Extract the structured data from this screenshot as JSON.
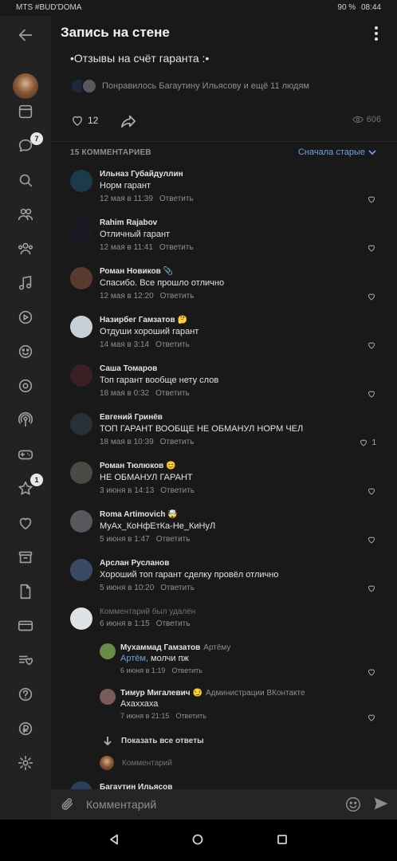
{
  "status_bar": {
    "carrier": "MTS #BUD'DOMA",
    "battery": "90 %",
    "time": "08:44"
  },
  "header": {
    "back_icon": "arrow-left-icon",
    "title": "Запись на стене",
    "menu_icon": "more-vertical-icon"
  },
  "sidebar": {
    "items": [
      {
        "icon": "profile-avatar"
      },
      {
        "icon": "news-icon"
      },
      {
        "icon": "messages-icon",
        "badge": "7"
      },
      {
        "icon": "search-icon"
      },
      {
        "icon": "friends-icon"
      },
      {
        "icon": "communities-icon"
      },
      {
        "icon": "music-icon"
      },
      {
        "icon": "video-icon"
      },
      {
        "icon": "games-icon"
      },
      {
        "icon": "clips-icon"
      },
      {
        "icon": "podcasts-icon"
      },
      {
        "icon": "gamepad-icon"
      },
      {
        "icon": "bookmarks-icon",
        "badge": "1"
      },
      {
        "icon": "likes-icon"
      },
      {
        "icon": "archive-icon"
      },
      {
        "icon": "documents-icon"
      },
      {
        "icon": "payments-icon"
      },
      {
        "icon": "wishlist-icon"
      },
      {
        "icon": "help-icon"
      },
      {
        "icon": "ruble-icon"
      },
      {
        "icon": "settings-icon"
      }
    ]
  },
  "post": {
    "text": "•Отзывы на счёт гаранта :•",
    "liked_by_text": "Понравилось Багаутину Ильясову и ещё 11 людям",
    "likes": "12",
    "views": "606"
  },
  "comments_section": {
    "count_label": "15 КОММЕНТАРИЕВ",
    "sort_label": "Сначала старые"
  },
  "comments": [
    {
      "author": "Ильназ Губайдуллин",
      "emoji": "",
      "text": "Норм гарант",
      "date": "12 мая в 11:39",
      "reply": "Ответить",
      "likes": "",
      "avatar_color": "#1b3a4a"
    },
    {
      "author": "Rahim Rajabov",
      "emoji": "",
      "text": "Отличный  гарант",
      "date": "12 мая в 11:41",
      "reply": "Ответить",
      "likes": "",
      "avatar_color": "#1a1a24"
    },
    {
      "author": "Роман Новиков",
      "emoji": "📎",
      "text": "Спасибо. Все прошло отлично",
      "date": "12 мая в 12:20",
      "reply": "Ответить",
      "likes": "",
      "avatar_color": "#5a3a2e"
    },
    {
      "author": "Назирбег Гамзатов",
      "emoji": "🤔",
      "text": "Отдуши  хороший гарант",
      "date": "14 мая в 3:14",
      "reply": "Ответить",
      "likes": "",
      "avatar_color": "#c9cfd6"
    },
    {
      "author": "Саша Томаров",
      "emoji": "",
      "text": "Топ гарант вообще нету слов",
      "date": "18 мая в 0:32",
      "reply": "Ответить",
      "likes": "",
      "avatar_color": "#3a1f24"
    },
    {
      "author": "Евгений Гринёв",
      "emoji": "",
      "text": "ТОП ГАРАНТ ВООБЩЕ НЕ ОБМАНУЛ НОРМ ЧЕЛ",
      "date": "18 мая в 10:39",
      "reply": "Ответить",
      "likes": "1",
      "avatar_color": "#2a3038"
    },
    {
      "author": "Роман Тюлюков",
      "emoji": "😊",
      "text": "НЕ ОБМАНУЛ ГАРАНТ",
      "date": "3 июня в 14:13",
      "reply": "Ответить",
      "likes": "",
      "avatar_color": "#4a4a46"
    },
    {
      "author": "Roma Artimovich",
      "emoji": "🤯",
      "text": "МуАх_КоНфЕтКа-Не_КиНуЛ",
      "date": "5 июня в 1:47",
      "reply": "Ответить",
      "likes": "",
      "avatar_color": "#5a5660"
    },
    {
      "author": "Арслан Русланов",
      "emoji": "",
      "text": "Хороший топ гарант сделку провёл отлично",
      "date": "5 июня в 10:20",
      "reply": "Ответить",
      "likes": "",
      "avatar_color": "#3a4a66"
    },
    {
      "author": "Комментарий был удалён",
      "emoji": "",
      "text": "",
      "date": "6 июня в 1:15",
      "reply": "Ответить",
      "likes": "",
      "avatar_color": "#dfe2e6",
      "deleted": true
    }
  ],
  "replies": [
    {
      "author": "Мухаммад Гамзатов",
      "emoji": "",
      "to": "Артёму",
      "mention": "Артём,",
      "text": " молчи пж",
      "date": "6 июня в 1:19",
      "reply": "Ответить",
      "avatar_color": "#6a8a4a"
    },
    {
      "author": "Тимур Мигалевич",
      "emoji": "😏",
      "to": "Администрации ВКонтакте",
      "mention": "",
      "text": "Ахаххаха",
      "date": "7 июня в 21:15",
      "reply": "Ответить",
      "avatar_color": "#7a5a5a"
    }
  ],
  "show_all_replies": "Показать все ответы",
  "reply_prompt": "Комментарий",
  "next_comment_author": "Багаутин Ильясов",
  "composer": {
    "placeholder": "Комментарий"
  }
}
